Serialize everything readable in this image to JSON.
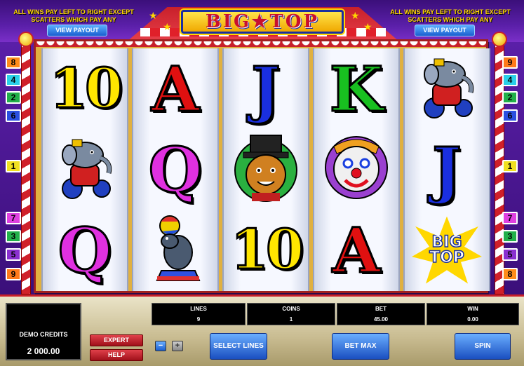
{
  "header": {
    "info_left": "ALL WINS PAY LEFT TO RIGHT EXCEPT SCATTERS WHICH PAY ANY",
    "info_right": "ALL WINS PAY LEFT TO RIGHT EXCEPT SCATTERS WHICH PAY ANY",
    "payout_left": "VIEW PAYOUT",
    "payout_right": "VIEW PAYOUT",
    "logo": "BIG★TOP"
  },
  "paylines_left": [
    {
      "label": "8",
      "color": "#ff8c1a"
    },
    {
      "label": "4",
      "color": "#2ad0e8"
    },
    {
      "label": "2",
      "color": "#22b04a"
    },
    {
      "label": "6",
      "color": "#2a4fe0"
    },
    {
      "label": "1",
      "color": "#f0e020"
    },
    {
      "label": "7",
      "color": "#e040e0"
    },
    {
      "label": "3",
      "color": "#22b04a"
    },
    {
      "label": "5",
      "color": "#8a30d0"
    },
    {
      "label": "9",
      "color": "#ff7a1a"
    }
  ],
  "paylines_right": [
    {
      "label": "9",
      "color": "#ff7a1a"
    },
    {
      "label": "4",
      "color": "#2ad0e8"
    },
    {
      "label": "2",
      "color": "#22b04a"
    },
    {
      "label": "6",
      "color": "#2a4fe0"
    },
    {
      "label": "1",
      "color": "#f0e020"
    },
    {
      "label": "7",
      "color": "#e040e0"
    },
    {
      "label": "3",
      "color": "#22b04a"
    },
    {
      "label": "5",
      "color": "#8a30d0"
    },
    {
      "label": "8",
      "color": "#ff8c1a"
    }
  ],
  "reels": [
    [
      {
        "type": "letter",
        "text": "10",
        "color": "#ffe600"
      },
      {
        "type": "character",
        "name": "elephant",
        "icon": "elephant-icon",
        "color": "#7a8aa0"
      },
      {
        "type": "letter",
        "text": "Q",
        "color": "#e030e0"
      }
    ],
    [
      {
        "type": "letter",
        "text": "A",
        "color": "#e01010"
      },
      {
        "type": "letter",
        "text": "Q",
        "color": "#e030e0"
      },
      {
        "type": "character",
        "name": "seal",
        "icon": "seal-icon",
        "color": "#4a5a70"
      }
    ],
    [
      {
        "type": "letter",
        "text": "J",
        "color": "#1a2fe0"
      },
      {
        "type": "character",
        "name": "lion",
        "icon": "lion-icon",
        "color": "#2ab040"
      },
      {
        "type": "letter",
        "text": "10",
        "color": "#ffe600"
      }
    ],
    [
      {
        "type": "letter",
        "text": "K",
        "color": "#18c020"
      },
      {
        "type": "character",
        "name": "clown",
        "icon": "clown-icon",
        "color": "#f0f0f0"
      },
      {
        "type": "letter",
        "text": "A",
        "color": "#e01010"
      }
    ],
    [
      {
        "type": "character",
        "name": "elephant",
        "icon": "elephant-icon",
        "color": "#7a8aa0"
      },
      {
        "type": "letter",
        "text": "J",
        "color": "#1a2fe0"
      },
      {
        "type": "scatter",
        "line1": "BIG",
        "line2": "TOP"
      }
    ]
  ],
  "panel": {
    "credits_label": "DEMO CREDITS",
    "credits_value": "2 000.00",
    "expert_label": "EXPERT",
    "help_label": "HELP",
    "minus_label": "−",
    "plus_label": "+",
    "lines_label": "LINES",
    "lines_value": "9",
    "coins_label": "COINS",
    "coins_value": "1",
    "bet_label": "BET",
    "bet_value": "45.00",
    "win_label": "WIN",
    "win_value": "0.00",
    "select_lines_label": "SELECT LINES",
    "bet_max_label": "BET MAX",
    "spin_label": "SPIN"
  }
}
